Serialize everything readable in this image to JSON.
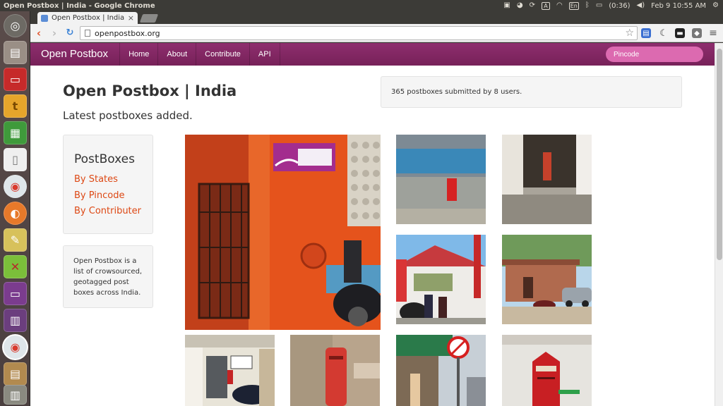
{
  "system": {
    "window_title": "Open Postbox | India - Google Chrome",
    "battery": "(0:36)",
    "keyboard_layout": "En",
    "clock": "Feb  9 10:55 AM"
  },
  "browser": {
    "tab_title": "Open Postbox | India",
    "url": "openpostbox.org"
  },
  "site": {
    "brand": "Open Postbox",
    "nav": [
      "Home",
      "About",
      "Contribute",
      "API"
    ],
    "search_placeholder": "Pincode"
  },
  "main": {
    "title": "Open Postbox | India",
    "subtitle": "Latest postboxes added.",
    "stats": "365 postboxes submitted by 8 users."
  },
  "sidebar": {
    "heading": "PostBoxes",
    "links": [
      "By States",
      "By Pincode",
      "By Contributer"
    ],
    "about": "Open Postbox is a list of crowsourced, geotagged post boxes across India."
  },
  "colors": {
    "navbar": "#772159",
    "link": "#dd4814",
    "search_bg": "#dc6ab0"
  }
}
